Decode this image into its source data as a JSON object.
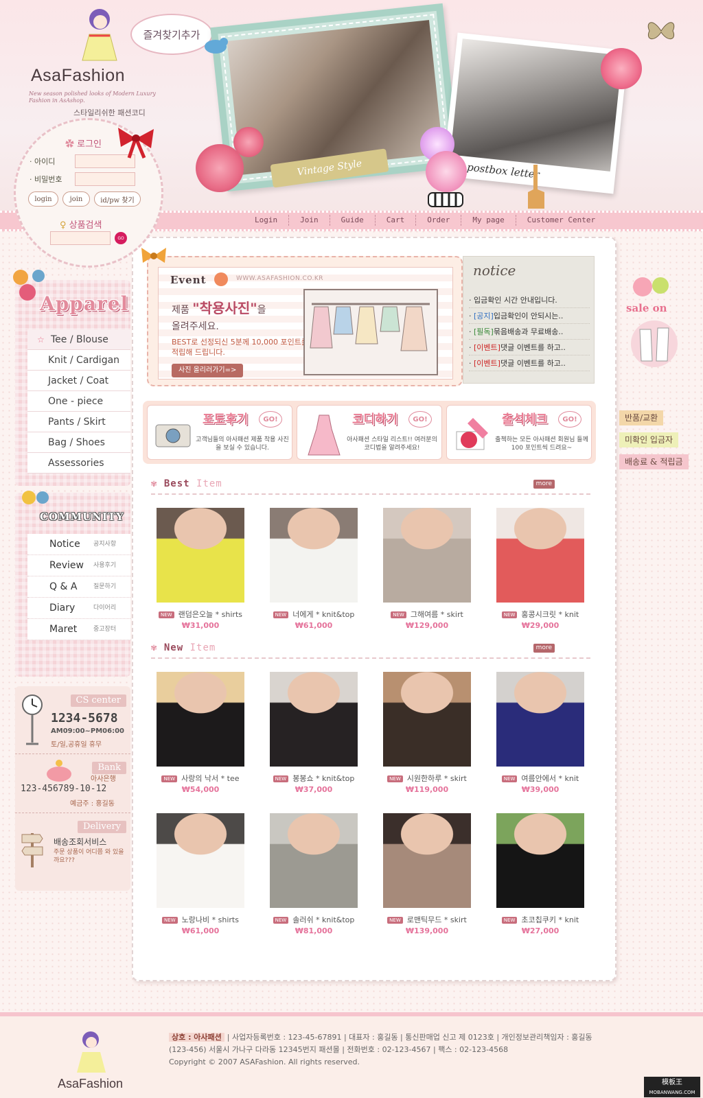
{
  "header": {
    "logo_text": "AsaFashion",
    "logo_sub": "New season polished looks of Modern Luxury Fashion in AsAshop.",
    "tagline": "스타일리쉬한 패션코디",
    "bookmark": "즐겨찾기추가",
    "vintage_ribbon": "Vintage Style",
    "postbox_text": "postbox letter"
  },
  "nav": [
    "Login",
    "Join",
    "Guide",
    "Cart",
    "Order",
    "My page",
    "Customer Center"
  ],
  "login": {
    "title": "로그인",
    "id_label": "· 아이디",
    "pw_label": "· 비밀번호",
    "buttons": [
      "login",
      "join",
      "id/pw 찾기"
    ],
    "search_title": "상품검색",
    "go": "GO"
  },
  "apparel": {
    "title": "Apparel",
    "items": [
      "Tee / Blouse",
      "Knit / Cardigan",
      "Jacket / Coat",
      "One - piece",
      "Pants / Skirt",
      "Bag / Shoes",
      "Assessories"
    ]
  },
  "community": {
    "title": "COMMUNITY",
    "items": [
      {
        "en": "Notice",
        "kr": "공지사항"
      },
      {
        "en": "Review",
        "kr": "사용후기"
      },
      {
        "en": "Q & A",
        "kr": "질문하기"
      },
      {
        "en": "Diary",
        "kr": "다이어리"
      },
      {
        "en": "Maret",
        "kr": "중고장터"
      }
    ]
  },
  "cs": {
    "cs_tag": "CS center",
    "phone": "1234-5678",
    "hours": "AM09:00~PM06:00",
    "holiday": "토/일,공휴일 휴무",
    "bank_tag": "Bank",
    "bank_name": "아사은행",
    "account": "123-456789-10-12",
    "holder": "예금주 : 홍길동",
    "delivery_tag": "Delivery",
    "delivery_title": "배송조회서비스",
    "delivery_desc": "주문 상품이 어디쯤 와 있을까요???"
  },
  "event": {
    "label": "Event",
    "url": "WWW.ASAFASHION.CO.KR",
    "line1_pre": "제품",
    "line1_big": "\"착용사진\"",
    "line1_post": "을",
    "line2": "올려주세요.",
    "desc": "BEST로 선정되신 5분께 10,000 포인트를 적립해 드립니다.",
    "button": "사진 올리러가기=>"
  },
  "notice": {
    "title": "notice",
    "items": [
      {
        "tag": "",
        "text": "입금확인 시간 안내입니다.",
        "color": ""
      },
      {
        "tag": "[공지]",
        "text": "입금확인이 안되시는..",
        "color": "blue"
      },
      {
        "tag": "[필독]",
        "text": "묶음배송과 무료배송..",
        "color": "green"
      },
      {
        "tag": "[이벤트]",
        "text": "댓글 이벤트를 하고..",
        "color": "red"
      },
      {
        "tag": "[이벤트]",
        "text": "댓글 이벤트를 하고..",
        "color": "red"
      }
    ]
  },
  "promos": [
    {
      "title": "포토후기",
      "go": "GO!",
      "desc": "고객님들의 아사패션 제품 착용 사진을 보실 수 있습니다."
    },
    {
      "title": "코디하기",
      "go": "GO!",
      "desc": "아사패션 스타일 리스트!! 여러분의 코디법을 알려주세요!"
    },
    {
      "title": "출석체크",
      "go": "GO!",
      "desc": "출첵하는 모든 아사패션 회원님 들께 100 포인트씩 드려요~"
    }
  ],
  "best": {
    "title_a": "Best",
    "title_b": "Item",
    "more": "more",
    "items": [
      {
        "name": "랜덤은오늘 * shirts",
        "price": "₩31,000",
        "c1": "#e8e34a",
        "c2": "#6b5a4f"
      },
      {
        "name": "너에게 * knit&top",
        "price": "₩61,000",
        "c1": "#f3f3f0",
        "c2": "#8a7c74"
      },
      {
        "name": "그해여름 * skirt",
        "price": "₩129,000",
        "c1": "#b8aba0",
        "c2": "#d4c8bf"
      },
      {
        "name": "홍콩시크릿 * knit",
        "price": "₩29,000",
        "c1": "#e25b5b",
        "c2": "#efe7e3"
      }
    ]
  },
  "new": {
    "title_a": "New",
    "title_b": "Item",
    "more": "more",
    "items": [
      {
        "name": "사랑의 낙서 * tee",
        "price": "₩54,000",
        "c1": "#1c1a1b",
        "c2": "#e9ce9d"
      },
      {
        "name": "봉봉쇼 * knit&top",
        "price": "₩37,000",
        "c1": "#262223",
        "c2": "#d9d4cf"
      },
      {
        "name": "시원한하루 * skirt",
        "price": "₩119,000",
        "c1": "#3a2e27",
        "c2": "#b89070"
      },
      {
        "name": "여름안에서 * knit",
        "price": "₩39,000",
        "c1": "#2a2c7a",
        "c2": "#d4d1ce"
      },
      {
        "name": "노랑나비 * shirts",
        "price": "₩61,000",
        "c1": "#f7f5f2",
        "c2": "#4d4a48"
      },
      {
        "name": "솔러쉬 * knit&top",
        "price": "₩81,000",
        "c1": "#9c9a92",
        "c2": "#c9c7c1"
      },
      {
        "name": "로맨틱무드 * skirt",
        "price": "₩139,000",
        "c1": "#a68a7a",
        "c2": "#3b2f2b"
      },
      {
        "name": "초코칩쿠키 * knit",
        "price": "₩27,000",
        "c1": "#151515",
        "c2": "#7ca45c"
      }
    ]
  },
  "right_deco": {
    "sale": "sale on",
    "tags": [
      "반품/교환",
      "미확인 입금자",
      "배송료 & 적립금"
    ]
  },
  "footer": {
    "logo": "AsaFashion",
    "company_label": "상호 : 아사패션",
    "line1": "| 사업자등록번호 : 123-45-67891 | 대표자 : 홍길동 | 통신판매업 신고 제 0123호 | 개인정보관리책임자 : 홍길동",
    "line2": "(123-456) 서울시 가나구 다라동 12345번지 패션몰 | 전화번호 : 02-123-4567 | 팩스 : 02-123-4568",
    "line3": "Copyright © 2007 ASAFashion. All rights reserved.",
    "watermark_a": "模板王",
    "watermark_b": "MOBANWANG.COM"
  },
  "colors": {
    "accent": "#e5739b",
    "nav": "#f7c7cf",
    "brand_text": "#4a3b3f"
  }
}
